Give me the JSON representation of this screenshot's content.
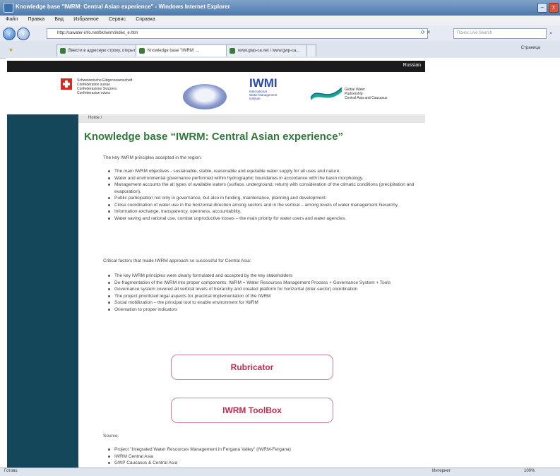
{
  "window": {
    "title": "Knowledge base \"IWRM: Central Asian experience\" - Windows Internet Explorer",
    "minimize": "–",
    "close": "×"
  },
  "menubar": [
    "Файл",
    "Правка",
    "Вид",
    "Избранное",
    "Сервис",
    "Справка"
  ],
  "addressbar": {
    "url": "http://cawater-info.net/bk/iwrm/index_e.htm",
    "search_placeholder": "Поиск Live Search"
  },
  "tabs": [
    {
      "label": "Ввести в адресную строку, открыть...",
      "active": false
    },
    {
      "label": "Knowledge base \"IWRM: ...",
      "active": true
    },
    {
      "label": "www.gwp-ca.net / www.gwp-ca...",
      "active": false
    }
  ],
  "toolbar_right": "Страница",
  "site": {
    "top_link": "Russian",
    "swiss_text": "Schweizerische Eidgenossenschaft\nConfédération suisse\nConfederazione Svizzera\nConfederaziun svizra",
    "iwmi": {
      "big": "IWMI",
      "small": "International\nWater Management\nInstitute"
    },
    "gwp_text": "Global Water\nPartnership\nCentral Asia and Caucasus",
    "breadcrumb": "Home /",
    "title": "Knowledge base “IWRM: Central Asian experience”",
    "intro1": "The key IWRM principles accepted in the region:",
    "principles": [
      "The main IWRM objectives - sustainable, stable, reasonable and equitable water supply for all uses and nature.",
      "Water and environmental governance performed within hydrographic boundaries in accordance with the basin morphology.",
      "Management accounts the all types of available waters (surface, underground, return) with consideration of the climatic conditions (precipitation and evaporation).",
      "Public participation not only in governance, but also in funding, maintenance, planning and development.",
      "Close coordination of water use in the horizontal direction among sectors and in the vertical – among levels of water management hierarchy.",
      "Information exchange, transparency, openness, accountability.",
      "Water saving and rational use, combat unproductive losses – the main priority for water users and water agencies."
    ],
    "intro2": "Critical factors that made IWRM approach so successful for Central Asia:",
    "factors": [
      "The key IWRM principles were clearly formulated and accepted by the key stakeholders",
      "De-fragmentation of the IWRM into proper components: IWRM = Water Resources Management Process + Governance System + Tools",
      "Governance system covered all vertical levels of hierarchy and created platform for horizontal (inter-sector) coordination",
      "The project prioritized legal aspects for practical implementation of the IWRM",
      "Social mobilization – the principal tool to enable environment for IWRM",
      "Orientation to proper indicators"
    ],
    "btn1": "Rubricator",
    "btn2": "IWRM ToolBox",
    "sources_label": "Source:",
    "sources": [
      "Project \"Integrated Water Resources Management in Fergana Valley\" (IWRM-Fergana)",
      "IWRM Central Asia",
      "GWP Caucasus & Central Asia"
    ]
  },
  "statusbar": {
    "left": "Готово",
    "zone": "Интернет",
    "zoom": "100%"
  }
}
